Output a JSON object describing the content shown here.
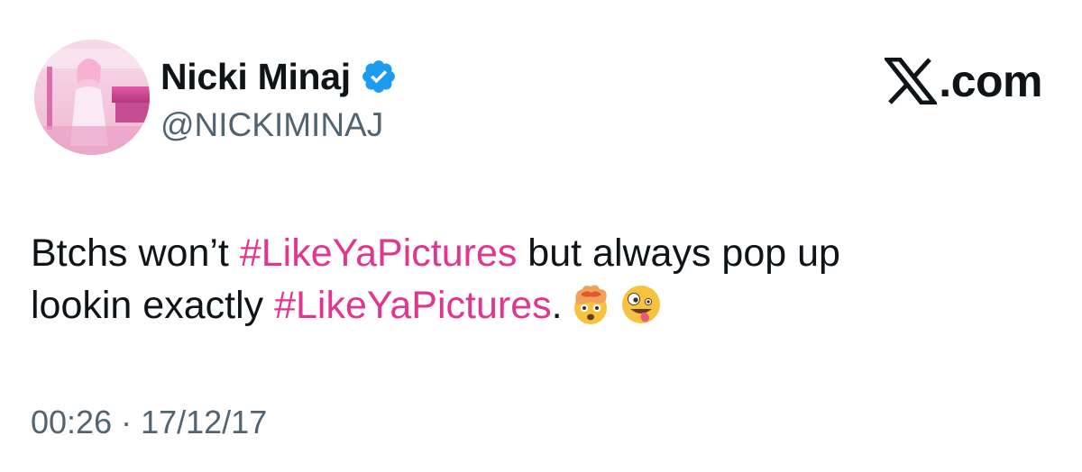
{
  "author": {
    "display_name": "Nicki Minaj",
    "handle": "@NICKIMINAJ",
    "verified": true,
    "avatar_icon": "profile-photo"
  },
  "brand": {
    "logo_icon": "x-logo-icon",
    "site_label": ".com"
  },
  "tweet": {
    "line1": {
      "pre": "Btchs won’t ",
      "hashtag": "#LikeYaPictures",
      "post": " but always pop up"
    },
    "line2": {
      "pre": "lookin exactly ",
      "hashtag": "#LikeYaPictures",
      "post": ".",
      "emojis": [
        "exploding-head-emoji",
        "zany-face-emoji"
      ]
    }
  },
  "meta": {
    "time": "00:26",
    "separator": " · ",
    "date": "17/12/17"
  },
  "colors": {
    "text": "#0f1419",
    "secondary": "#536471",
    "hashtag": "#e0368d",
    "verified_badge": "#1d9bf0"
  }
}
